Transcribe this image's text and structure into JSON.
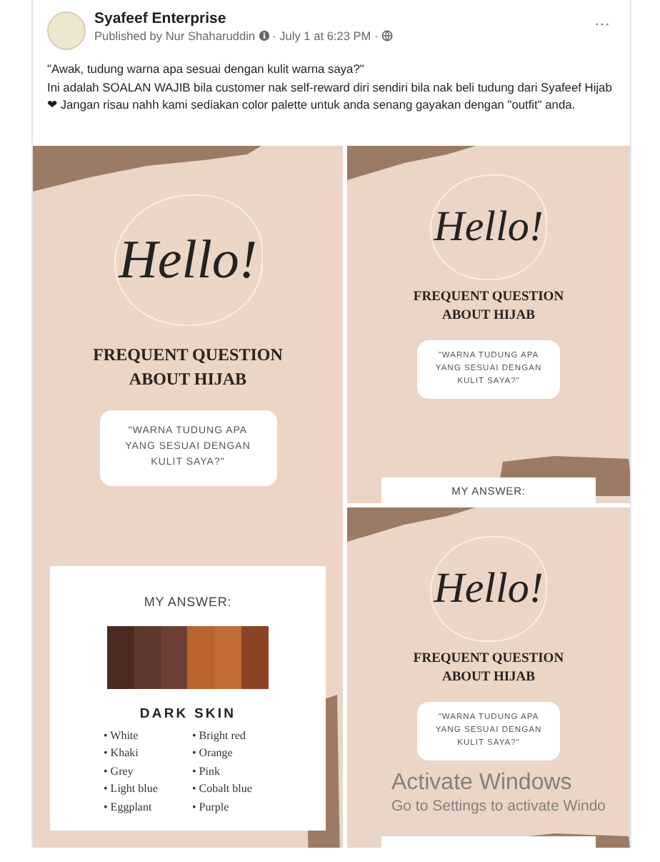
{
  "post": {
    "page_name": "Syafeef Enterprise",
    "byline": "Published by Nur Shaharuddin",
    "timestamp": "· July 1 at 6:23 PM ·",
    "more_button": "···",
    "message": [
      "\"Awak, tudung warna apa sesuai dengan kulit warna saya?\"",
      "Ini adalah SOALAN WAJIB bila customer nak self-reward diri sendiri bila nak beli tudung dari Syafeef Hijab ❤ Jangan risau nahh  kami sediakan color palette untuk anda senang gayakan dengan \"outfit\" anda."
    ],
    "images": [
      {
        "hello": "Hello!",
        "heading": [
          "FREQUENT QUESTION",
          "ABOUT HIJAB"
        ],
        "question": [
          "\"WARNA TUDUNG APA",
          "YANG SESUAI DENGAN",
          "KULIT SAYA?\""
        ],
        "answer": {
          "title": "MY ANSWER:",
          "palette": [
            {
              "color": "#4b2a22"
            },
            {
              "color": "#5d382e"
            },
            {
              "color": "#6c4034"
            },
            {
              "color": "#b9652d"
            },
            {
              "color": "#c26c35"
            },
            {
              "color": "#8b4525"
            }
          ],
          "skin": "DARK SKIN",
          "colors_left": [
            "• White",
            "• Khaki",
            "• Grey",
            "• Light blue",
            "• Eggplant"
          ],
          "colors_right": [
            "• Bright red",
            "• Orange",
            "• Pink",
            "• Cobalt blue",
            "• Purple"
          ]
        }
      },
      {
        "hello": "Hello!",
        "heading": [
          "FREQUENT QUESTION",
          "ABOUT HIJAB"
        ],
        "question": [
          "\"WARNA TUDUNG APA",
          "YANG SESUAI DENGAN",
          "KULIT SAYA?\""
        ],
        "answer": {
          "title": "MY ANSWER:"
        }
      },
      {
        "hello": "Hello!",
        "heading": [
          "FREQUENT QUESTION",
          "ABOUT HIJAB"
        ],
        "question": [
          "\"WARNA TUDUNG APA",
          "YANG SESUAI DENGAN",
          "KULIT SAYA?\""
        ]
      }
    ]
  },
  "os_notice": {
    "title": "Activate Windows",
    "subtitle": "Go to Settings to activate Windo"
  }
}
